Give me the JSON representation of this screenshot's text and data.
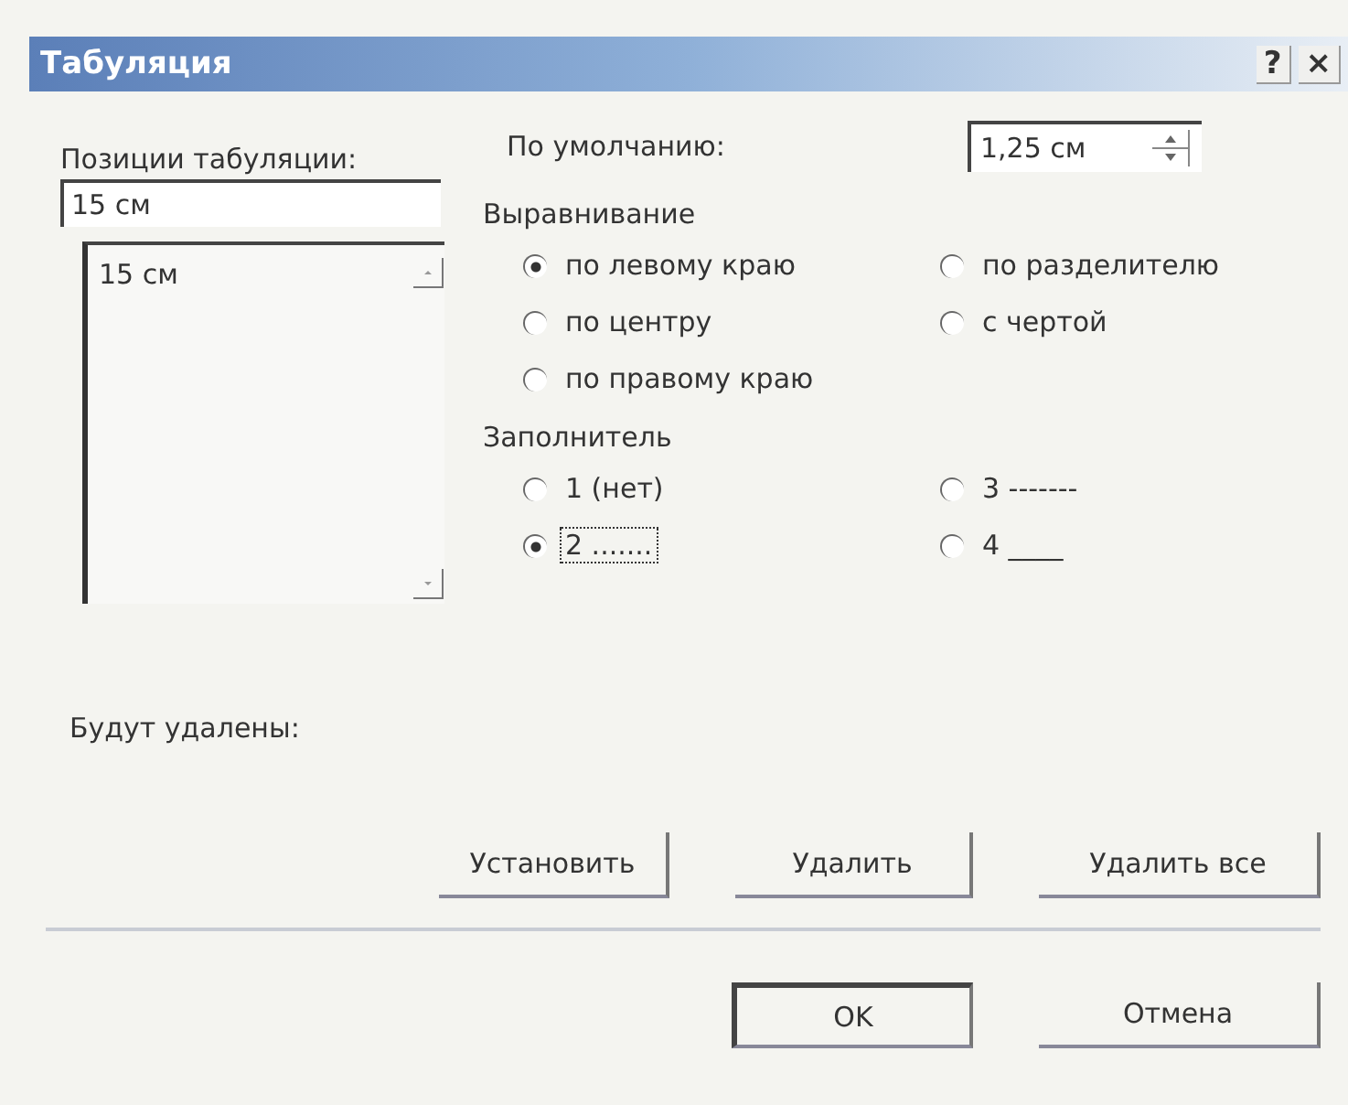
{
  "window": {
    "title": "Табуляция",
    "help_button": "?",
    "close_button": "×"
  },
  "tab_stops": {
    "label": "Позиции табуляции:",
    "value": "15 см",
    "list": [
      "15 см"
    ]
  },
  "default_stops": {
    "label": "По умолчанию:",
    "value": "1,25 см"
  },
  "alignment": {
    "label": "Выравнивание",
    "options": [
      {
        "label": "по левому краю",
        "selected": true
      },
      {
        "label": "по разделителю",
        "selected": false
      },
      {
        "label": "по центру",
        "selected": false
      },
      {
        "label": "с чертой",
        "selected": false
      },
      {
        "label": "по правому краю",
        "selected": false
      }
    ]
  },
  "leader": {
    "label": "Заполнитель",
    "options": [
      {
        "label": "1 (нет)",
        "selected": false,
        "focused": false
      },
      {
        "label": "3 -------",
        "selected": false,
        "focused": false
      },
      {
        "label": "2 .......",
        "selected": true,
        "focused": true
      },
      {
        "label": "4 ____",
        "selected": false,
        "focused": false
      }
    ]
  },
  "cleared": {
    "label": "Будут удалены:"
  },
  "action_buttons": [
    "Установить",
    "Удалить",
    "Удалить все"
  ],
  "dialog_buttons": [
    {
      "label": "OK",
      "default": true
    },
    {
      "label": "Отмена",
      "default": false
    }
  ]
}
